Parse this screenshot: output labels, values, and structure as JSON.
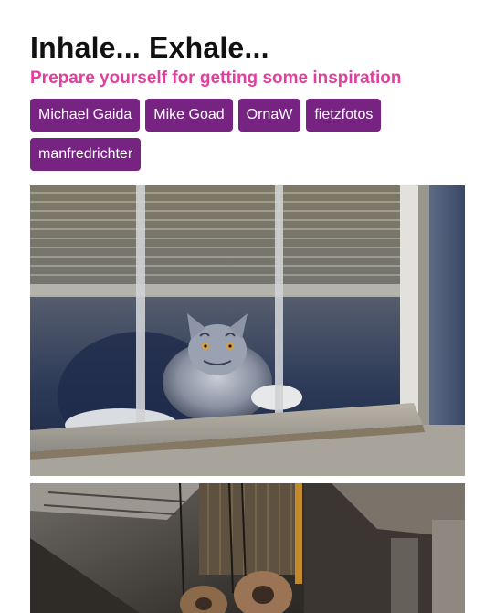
{
  "header": {
    "title": "Inhale... Exhale...",
    "subtitle": "Prepare yourself for getting some inspiration"
  },
  "tags": [
    {
      "label": "Michael Gaida"
    },
    {
      "label": "Mike Goad"
    },
    {
      "label": "OrnaW"
    },
    {
      "label": "fietzfotos"
    },
    {
      "label": "manfredrichter"
    }
  ],
  "photos": [
    {
      "subject": "cat-behind-window"
    },
    {
      "subject": "industrial-pulleys"
    }
  ],
  "colors": {
    "title": "#111111",
    "subtitle": "#e0409c",
    "tag_background": "#762382",
    "tag_text": "#ffffff"
  }
}
